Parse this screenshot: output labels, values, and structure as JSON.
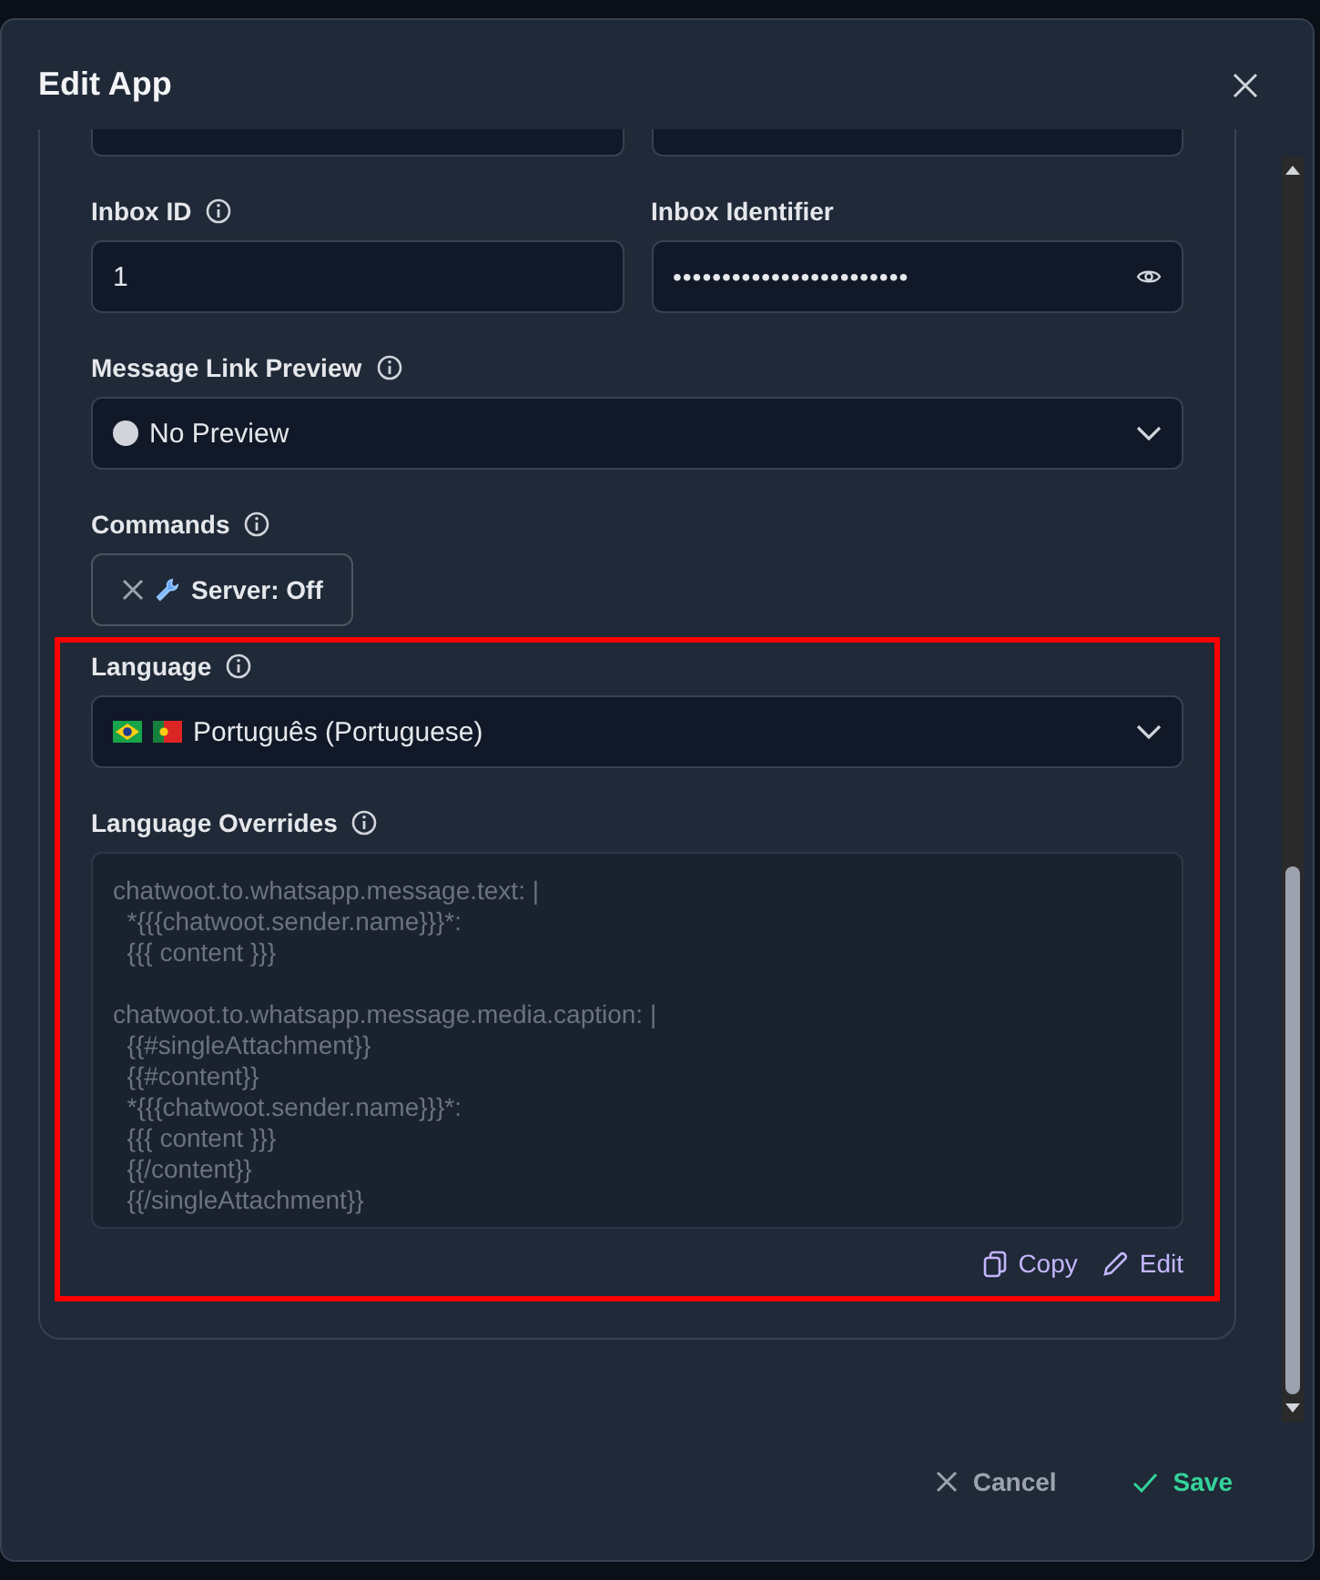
{
  "dialog": {
    "title": "Edit App"
  },
  "clipped_fields": [
    {
      "kind": "input"
    },
    {
      "kind": "input"
    }
  ],
  "inbox_fields": [
    {
      "label": "Inbox ID",
      "info": true,
      "kind": "text",
      "value": "1"
    },
    {
      "label": "Inbox Identifier",
      "info": false,
      "kind": "secret",
      "value": "••••••••••••••••••••••••"
    }
  ],
  "link_preview": {
    "label": "Message Link Preview",
    "info": true,
    "value": "No Preview"
  },
  "commands": {
    "label": "Commands",
    "info": true,
    "tags": [
      {
        "text": "Server: Off"
      }
    ]
  },
  "language_section": {
    "highlighted": true,
    "language": {
      "label": "Language",
      "info": true,
      "value": "Português (Portuguese)"
    },
    "overrides": {
      "label": "Language Overrides",
      "info": true,
      "text": "chatwoot.to.whatsapp.message.text: |\n  *{{{chatwoot.sender.name}}}*:\n  {{{ content }}}\n\nchatwoot.to.whatsapp.message.media.caption: |\n  {{#singleAttachment}}\n  {{#content}}\n  *{{{chatwoot.sender.name}}}*:\n  {{{ content }}}\n  {{/content}}\n  {{/singleAttachment}}",
      "actions": [
        {
          "kind": "copy",
          "label": "Copy"
        },
        {
          "kind": "edit",
          "label": "Edit"
        }
      ]
    }
  },
  "footer": [
    {
      "kind": "cancel",
      "label": "Cancel"
    },
    {
      "kind": "save",
      "label": "Save"
    }
  ]
}
